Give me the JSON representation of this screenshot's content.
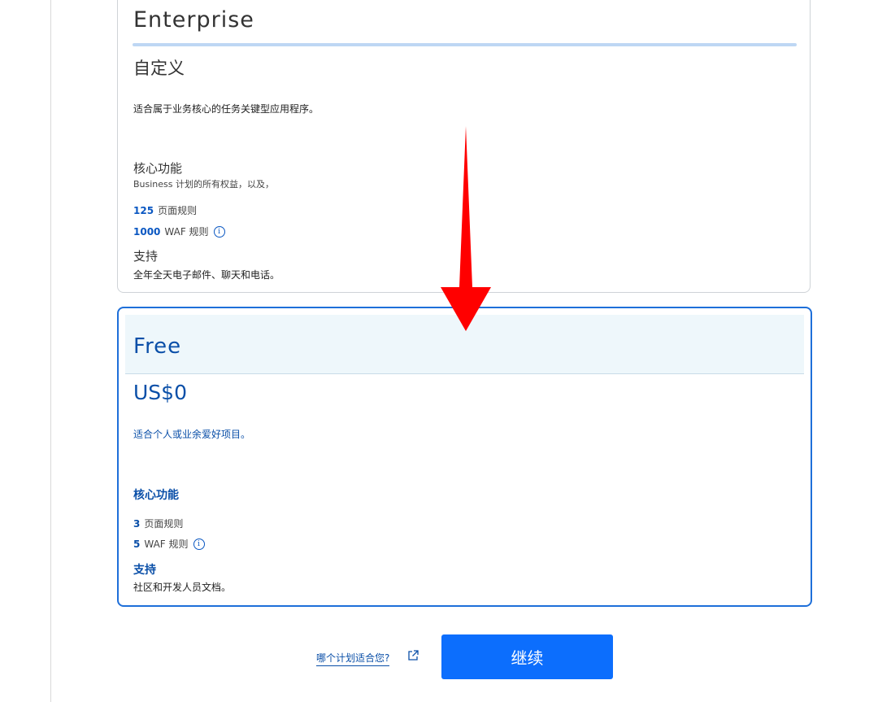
{
  "enterprise": {
    "title": "Enterprise",
    "price": "自定义",
    "description": "适合属于业务核心的任务关键型应用程序。",
    "core_title": "核心功能",
    "core_subtitle": "Business 计划的所有权益，以及，",
    "features": [
      {
        "num": "125",
        "label": "页面规则"
      },
      {
        "num": "1000",
        "label": "WAF 规则"
      }
    ],
    "support_title": "支持",
    "support_desc": "全年全天电子邮件、聊天和电话。"
  },
  "free": {
    "title": "Free",
    "price": "US$0",
    "description": "适合个人或业余爱好项目。",
    "core_title": "核心功能",
    "features": [
      {
        "num": "3",
        "label": "页面规则"
      },
      {
        "num": "5",
        "label": "WAF 规则"
      }
    ],
    "support_title": "支持",
    "support_desc": "社区和开发人员文档。"
  },
  "footer": {
    "which_plan_link": "哪个计划适合您?",
    "continue_label": "继续"
  },
  "icons": {
    "info": "info-icon",
    "external_link": "external-link-icon",
    "arrow": "red-down-arrow-icon"
  },
  "colors": {
    "accent_blue": "#0a4fa8",
    "button_blue": "#0c6efd",
    "selected_border": "#1e6fd9",
    "arrow_red": "#ff0000"
  }
}
